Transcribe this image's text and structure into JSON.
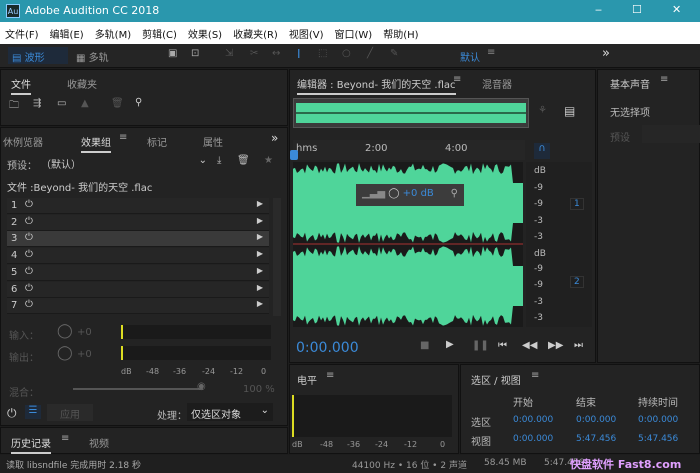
{
  "window": {
    "title": "Adobe Audition CC 2018",
    "app_icon": "Au",
    "min": "‒",
    "max": "☐",
    "close": "✕"
  },
  "menu": [
    "文件(F)",
    "编辑(E)",
    "多轨(M)",
    "剪辑(C)",
    "效果(S)",
    "收藏夹(R)",
    "视图(V)",
    "窗口(W)",
    "帮助(H)"
  ],
  "toolbar": {
    "waveform": "波形",
    "multitrack": "多轨",
    "workspace": "默认",
    "more": "»"
  },
  "files_panel": {
    "tabs": [
      "文件",
      "收藏夹"
    ]
  },
  "effects_panel": {
    "tabs": [
      "休例览器",
      "效果组",
      "标记",
      "属性"
    ],
    "more": "»",
    "preset_label": "预设：",
    "preset_value": "（默认）",
    "file_label": "文件 :Beyond- 我们的天空 .flac",
    "rack_rows": [
      "1",
      "2",
      "3",
      "4",
      "5",
      "6",
      "7"
    ],
    "selected_row": 3,
    "input_label": "输入：",
    "output_label": "输出：",
    "input_gain": "+0",
    "output_gain": "+0",
    "db_ticks": [
      "dB",
      "-48",
      "-36",
      "-24",
      "-12",
      "0"
    ],
    "mix_label": "混合：",
    "mix_value": "100 %",
    "apply": "应用",
    "process_label": "处理：",
    "process_value": "仅选区对象"
  },
  "history_panel": {
    "tabs": [
      "历史记录",
      "视频"
    ]
  },
  "editor": {
    "tabs": [
      "编辑器 : Beyond- 我们的天空 .flac",
      "混音器"
    ],
    "ruler": [
      "hms",
      "2:00",
      "4:00"
    ],
    "db_scale_1": [
      "dB",
      "-9",
      "-3",
      "-9",
      "-3"
    ],
    "db_scale_2": [
      "dB",
      "-9",
      "-3",
      "-9",
      "-3"
    ],
    "channels": [
      "1",
      "2"
    ],
    "hud_gain": "+0 dB",
    "time": "0:00.000"
  },
  "level_panel": {
    "title": "电平",
    "db_ticks": [
      "dB",
      "-48",
      "-36",
      "-24",
      "-12",
      "0"
    ]
  },
  "selection_panel": {
    "title": "选区 / 视图",
    "columns": [
      "开始",
      "结束",
      "持续时间"
    ],
    "rows": [
      {
        "label": "选区",
        "values": [
          "0:00.000",
          "0:00.000",
          "0:00.000"
        ]
      },
      {
        "label": "视图",
        "values": [
          "0:00.000",
          "5:47.456",
          "5:47.456"
        ]
      }
    ]
  },
  "essential_sound": {
    "title": "基本声音",
    "no_selection": "无选择项",
    "preset_label": "预设"
  },
  "status": {
    "message": "读取 libsndfile 完成用时 2.18 秒",
    "format": "44100 Hz • 16 位 • 2 声道",
    "size": "58.45 MB",
    "duration": "5:47.456",
    "watermark": "快盘软件 Fast8.com"
  },
  "colors": {
    "accent": "#3b8ad8",
    "waveform": "#4fd59a",
    "titlebar": "#2a97ad"
  }
}
